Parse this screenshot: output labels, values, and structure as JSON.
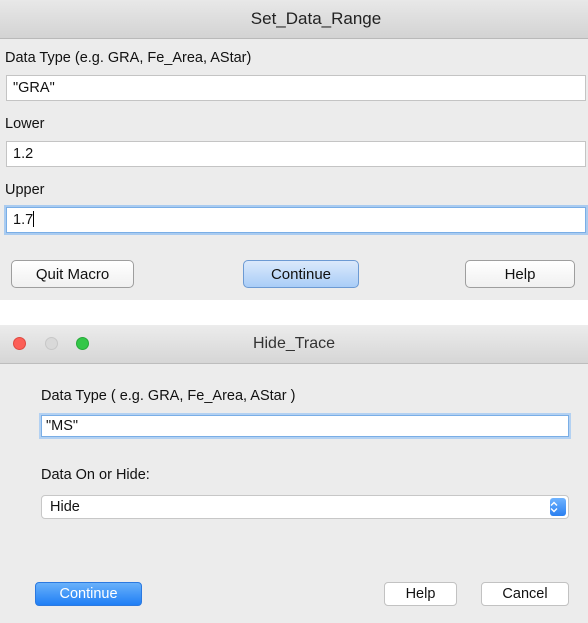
{
  "dialog1": {
    "title": "Set_Data_Range",
    "data_type_label": "Data Type (e.g. GRA, Fe_Area, AStar)",
    "data_type_value": "\"GRA\"",
    "lower_label": "Lower",
    "lower_value": "1.2",
    "upper_label": "Upper",
    "upper_value": "1.7",
    "buttons": {
      "quit": "Quit Macro",
      "continue": "Continue",
      "help": "Help"
    }
  },
  "dialog2": {
    "title": "Hide_Trace",
    "data_type_label": "Data Type ( e.g. GRA, Fe_Area, AStar )",
    "data_type_value": "\"MS\"",
    "select_label": "Data On or Hide:",
    "select_value": "Hide",
    "buttons": {
      "continue": "Continue",
      "help": "Help",
      "cancel": "Cancel"
    }
  },
  "colors": {
    "accent_blue": "#1f7ef5",
    "close_red": "#fc5f57",
    "zoom_green": "#33c748"
  },
  "icons": [
    "close-icon",
    "minimize-icon",
    "zoom-icon",
    "updown-chevron-icon"
  ]
}
